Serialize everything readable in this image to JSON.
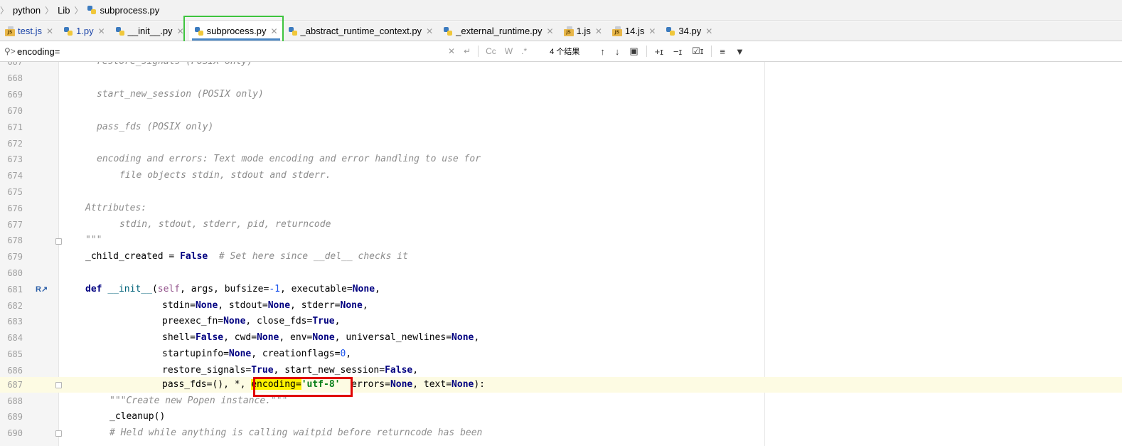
{
  "breadcrumb": {
    "items": [
      "python",
      "Lib",
      "subprocess.py"
    ]
  },
  "tabs": [
    {
      "label": "test.js",
      "icon": "js-file-icon"
    },
    {
      "label": "1.py",
      "icon": "python-file-icon"
    },
    {
      "label": "__init__.py",
      "icon": "python-file-icon"
    },
    {
      "label": "subprocess.py",
      "icon": "python-file-icon",
      "active": true
    },
    {
      "label": "_abstract_runtime_context.py",
      "icon": "python-file-icon"
    },
    {
      "label": "_external_runtime.py",
      "icon": "python-file-icon"
    },
    {
      "label": "1.js",
      "icon": "js-file-icon"
    },
    {
      "label": "14.js",
      "icon": "js-file-icon"
    },
    {
      "label": "34.py",
      "icon": "python-file-icon"
    }
  ],
  "search": {
    "query": "encoding=",
    "match_case": "Cc",
    "words": "W",
    "regex": ".*",
    "results": "4 个结果"
  },
  "editor": {
    "line_numbers": [
      "687",
      "668",
      "669",
      "670",
      "671",
      "672",
      "673",
      "674",
      "675",
      "676",
      "677",
      "678",
      "679",
      "680",
      "681",
      "682",
      "683",
      "684",
      "685",
      "686",
      "687",
      "688",
      "689",
      "690"
    ],
    "code": {
      "l0": "restore_signals (POSIX only)",
      "l2": "start_new_session (POSIX only)",
      "l4": "pass_fds (POSIX only)",
      "l6": "encoding and errors: Text mode encoding and error handling to use for",
      "l7": "file objects stdin, stdout and stderr.",
      "l9": "Attributes:",
      "l10": "stdin, stdout, stderr, pid, returncode",
      "l11": "\"\"\"",
      "l12_a": "_child_created = ",
      "l12_b": "False",
      "l12_c": "  # Set here since __del__ checks it",
      "l14_def": "def",
      "l14_name": "__init__",
      "l14_open": "(",
      "l14_self": "self",
      "l14_a": ", args, bufsize=",
      "l14_num": "-1",
      "l14_b": ", executable=",
      "l14_none": "None",
      "l14_c": ",",
      "l15_a": "stdin=",
      "l15_n1": "None",
      "l15_b": ", stdout=",
      "l15_n2": "None",
      "l15_c": ", stderr=",
      "l15_n3": "None",
      "l15_d": ",",
      "l16_a": "preexec_fn=",
      "l16_n1": "None",
      "l16_b": ", close_fds=",
      "l16_t": "True",
      "l16_c": ",",
      "l17_a": "shell=",
      "l17_f": "False",
      "l17_b": ", cwd=",
      "l17_n1": "None",
      "l17_c": ", env=",
      "l17_n2": "None",
      "l17_d": ", universal_newlines=",
      "l17_n3": "None",
      "l17_e": ",",
      "l18_a": "startupinfo=",
      "l18_n1": "None",
      "l18_b": ", creationflags=",
      "l18_num": "0",
      "l18_c": ",",
      "l19_a": "restore_signals=",
      "l19_t": "True",
      "l19_b": ", start_new_session=",
      "l19_f": "False",
      "l19_c": ",",
      "l20_a": "pass_fds=(), *, ",
      "l20_hl": "encoding=",
      "l20_str": "'utf-8'",
      "l20_b": "  errors=",
      "l20_n1": "None",
      "l20_c": ", text=",
      "l20_n2": "None",
      "l20_d": "):",
      "l21": "\"\"\"Create new Popen instance.\"\"\"",
      "l22": "_cleanup()",
      "l23": "# Held while anything is calling waitpid before returncode has been"
    }
  },
  "colors": {
    "highlight_red": "#e00000",
    "highlight_green": "#3ec43e",
    "search_match": "#fff200"
  }
}
